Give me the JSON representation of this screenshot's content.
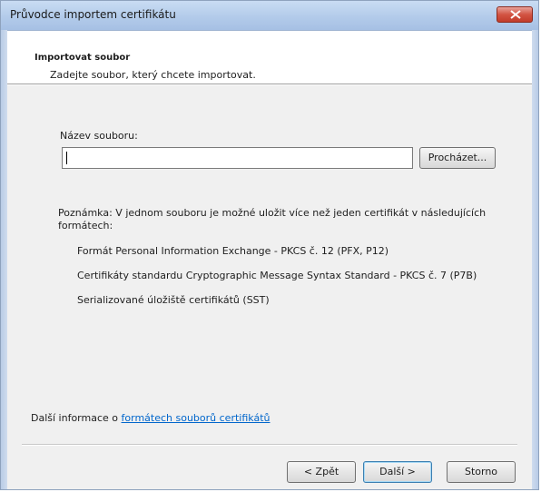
{
  "window": {
    "title": "Průvodce importem certifikátu"
  },
  "header": {
    "title": "Importovat soubor",
    "subtitle": "Zadejte soubor, který chcete importovat."
  },
  "form": {
    "filename_label": "Název souboru:",
    "filename_value": "",
    "browse_label": "Procházet..."
  },
  "note": {
    "text": "Poznámka: V jednom souboru je možné uložit více než jeden certifikát v následujících formátech:",
    "formats": [
      "Formát Personal Information Exchange - PKCS č. 12 (PFX, P12)",
      "Certifikáty standardu Cryptographic Message Syntax Standard - PKCS č. 7 (P7B)",
      "Serializované úložiště certifikátů (SST)"
    ]
  },
  "more_info": {
    "prefix": "Další informace o ",
    "link": "formátech souborů certifikátů"
  },
  "footer": {
    "back_label": "< Zpět",
    "next_label": "Další >",
    "cancel_label": "Storno"
  },
  "colors": {
    "titlebar": "#b3cbea",
    "close_button": "#d25443",
    "link": "#0066cc",
    "dialog_bg": "#f0f0f0"
  }
}
